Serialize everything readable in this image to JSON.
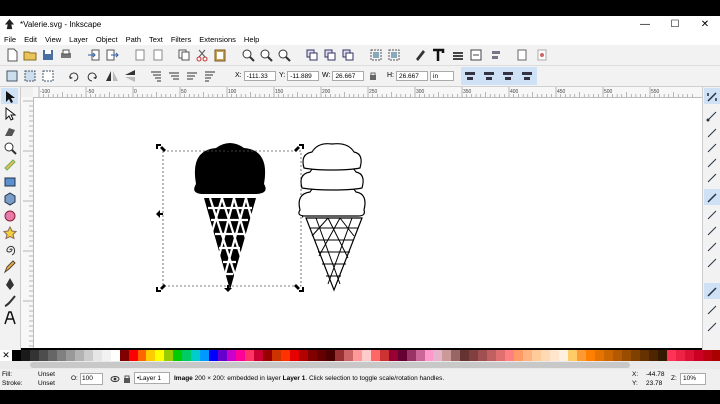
{
  "window": {
    "title": "*Valerie.svg - Inkscape"
  },
  "window_controls": {
    "minimize": "—",
    "maximize": "☐",
    "close": "✕"
  },
  "menu": [
    "File",
    "Edit",
    "View",
    "Layer",
    "Object",
    "Path",
    "Text",
    "Filters",
    "Extensions",
    "Help"
  ],
  "controls": {
    "x_label": "X:",
    "x_value": "-111.33",
    "y_label": "Y:",
    "y_value": "-11.889",
    "w_label": "W:",
    "w_value": "26.667",
    "h_label": "H:",
    "h_value": "26.667",
    "unit": "in"
  },
  "ruler_labels": [
    "-100",
    "-50",
    "0",
    "50",
    "100",
    "150",
    "200",
    "250",
    "300",
    "350",
    "400",
    "450",
    "500",
    "550"
  ],
  "palette_colors": [
    "#000000",
    "#1a1a1a",
    "#333333",
    "#4d4d4d",
    "#666666",
    "#808080",
    "#999999",
    "#b3b3b3",
    "#cccccc",
    "#e6e6e6",
    "#f2f2f2",
    "#ffffff",
    "#800000",
    "#ff0000",
    "#ff6600",
    "#ffcc00",
    "#ffff00",
    "#99cc00",
    "#00cc00",
    "#00cc66",
    "#00cccc",
    "#0099ff",
    "#0000ff",
    "#6600cc",
    "#cc00cc",
    "#ff0099",
    "#ff3366",
    "#cc0033",
    "#990000",
    "#cc3300",
    "#ff3300",
    "#e60000",
    "#b30000",
    "#800000",
    "#660000",
    "#4d0000",
    "#993333",
    "#cc6666",
    "#ff9999",
    "#ffcccc",
    "#ff6666",
    "#cc3333",
    "#990033",
    "#660033",
    "#993366",
    "#cc6699",
    "#ff99cc",
    "#e6b3cc",
    "#cc9999",
    "#996666",
    "#663333",
    "#804040",
    "#a05050",
    "#c06060",
    "#e07070",
    "#ff8080",
    "#ff9966",
    "#ffb380",
    "#ffcc99",
    "#ffd9b3",
    "#ffe6cc",
    "#fff0e0",
    "#ffcc66",
    "#ff9933",
    "#ff8000",
    "#e67300",
    "#cc6600",
    "#b35900",
    "#994d00",
    "#804000",
    "#663300",
    "#4d2600",
    "#331a00",
    "#ff3355",
    "#ee2244",
    "#dd1133",
    "#cc0022",
    "#bb0011",
    "#aa0000"
  ],
  "status": {
    "fill_label": "Fill:",
    "fill_value": "Unset",
    "stroke_label": "Stroke:",
    "stroke_value": "Unset",
    "opacity_label": "O:",
    "opacity_value": "100",
    "layer_value": "•Layer 1",
    "message_bold": "Image",
    "message_rest": " 200 × 200: embedded in layer ",
    "message_layer": "Layer 1",
    "message_end": ". Click selection to toggle scale/rotation handles.",
    "coord_x_label": "X:",
    "coord_x_value": "-44.78",
    "coord_y_label": "Y:",
    "coord_y_value": "23.78",
    "zoom_label": "Z:",
    "zoom_value": "10%"
  },
  "colors": {
    "accent_blue": "#3a6fc4",
    "toolbar_bg": "#f2f2f2",
    "canvas_bg": "#ffffff"
  }
}
